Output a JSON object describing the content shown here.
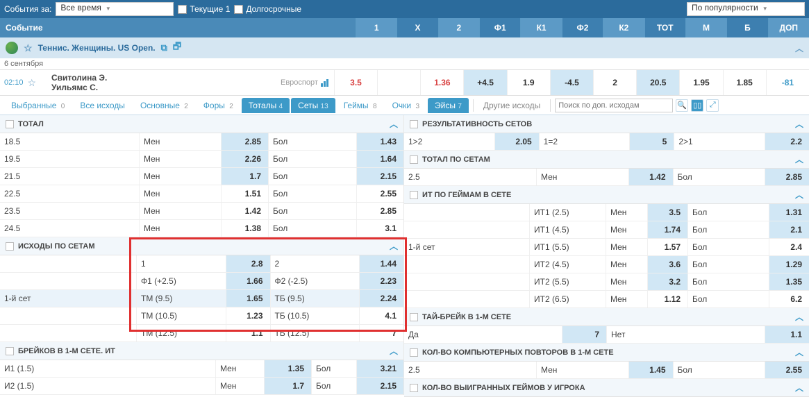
{
  "topbar": {
    "events_for": "События за:",
    "time_select": "Все время",
    "current": "Текущие 1",
    "longterm": "Долгосрочные",
    "sort_select": "По популярности"
  },
  "header": {
    "event": "Событие",
    "cols": [
      "1",
      "Х",
      "2",
      "Ф1",
      "К1",
      "Ф2",
      "К2",
      "ТОТ",
      "М",
      "Б",
      "ДОП"
    ]
  },
  "category": {
    "title": "Теннис. Женщины. US Open."
  },
  "date": "6 сентября",
  "match": {
    "time": "02:10",
    "p1": "Свитолина Э.",
    "p2": "Уильямс С.",
    "channel": "Евроспорт",
    "odds": [
      "3.5",
      "",
      "1.36",
      "+4.5",
      "1.9",
      "-4.5",
      "2",
      "20.5",
      "1.95",
      "1.85",
      "-81"
    ]
  },
  "tabs": {
    "selected": {
      "label": "Выбранные",
      "count": "0"
    },
    "all": {
      "label": "Все исходы"
    },
    "main": {
      "label": "Основные",
      "count": "2"
    },
    "handicap": {
      "label": "Форы",
      "count": "2"
    },
    "totals": {
      "label": "Тоталы",
      "count": "4"
    },
    "sets": {
      "label": "Сеты",
      "count": "13"
    },
    "games": {
      "label": "Геймы",
      "count": "8"
    },
    "points": {
      "label": "Очки",
      "count": "3"
    },
    "aces": {
      "label": "Эйсы",
      "count": "7"
    },
    "other": "Другие исходы",
    "search_ph": "Поиск по доп. исходам"
  },
  "sections": {
    "total": {
      "title": "ТОТАЛ",
      "rows": [
        {
          "p": "18.5",
          "l1": "Мен",
          "v1": "2.85",
          "l2": "Бол",
          "v2": "1.43"
        },
        {
          "p": "19.5",
          "l1": "Мен",
          "v1": "2.26",
          "l2": "Бол",
          "v2": "1.64"
        },
        {
          "p": "21.5",
          "l1": "Мен",
          "v1": "1.7",
          "l2": "Бол",
          "v2": "2.15"
        },
        {
          "p": "22.5",
          "l1": "Мен",
          "v1": "1.51",
          "l2": "Бол",
          "v2": "2.55"
        },
        {
          "p": "23.5",
          "l1": "Мен",
          "v1": "1.42",
          "l2": "Бол",
          "v2": "2.85"
        },
        {
          "p": "24.5",
          "l1": "Мен",
          "v1": "1.38",
          "l2": "Бол",
          "v2": "3.1"
        }
      ]
    },
    "bysets": {
      "title": "ИСХОДЫ ПО СЕТАМ",
      "set_label": "1-й сет",
      "rows": [
        {
          "l1": "1",
          "v1": "2.8",
          "l2": "2",
          "v2": "1.44"
        },
        {
          "l1": "Ф1 (+2.5)",
          "v1": "1.66",
          "l2": "Ф2 (-2.5)",
          "v2": "2.23"
        },
        {
          "l1": "ТМ (9.5)",
          "v1": "1.65",
          "l2": "ТБ (9.5)",
          "v2": "2.24"
        },
        {
          "l1": "ТМ (10.5)",
          "v1": "1.23",
          "l2": "ТБ (10.5)",
          "v2": "4.1"
        },
        {
          "l1": "ТМ (12.5)",
          "v1": "1.1",
          "l2": "ТБ (12.5)",
          "v2": "7"
        }
      ]
    },
    "breaks": {
      "title": "БРЕЙКОВ В 1-М СЕТЕ. ИТ",
      "rows": [
        {
          "p": "И1 (1.5)",
          "l1": "Мен",
          "v1": "1.35",
          "l2": "Бол",
          "v2": "3.21"
        },
        {
          "p": "И2 (1.5)",
          "l1": "Мен",
          "v1": "1.7",
          "l2": "Бол",
          "v2": "2.15"
        }
      ]
    },
    "setperf": {
      "title": "РЕЗУЛЬТАТИВНОСТЬ СЕТОВ",
      "r": {
        "a": "1>2",
        "av": "2.05",
        "b": "1=2",
        "bv": "5",
        "c": "2>1",
        "cv": "2.2"
      }
    },
    "totalbysets": {
      "title": "ТОТАЛ ПО СЕТАМ",
      "r": {
        "p": "2.5",
        "l1": "Мен",
        "v1": "1.42",
        "l2": "Бол",
        "v2": "2.85"
      }
    },
    "itgames": {
      "title": "ИТ ПО ГЕЙМАМ В СЕТЕ",
      "set_label": "1-й сет",
      "rows": [
        {
          "p": "ИТ1 (2.5)",
          "l1": "Мен",
          "v1": "3.5",
          "l2": "Бол",
          "v2": "1.31"
        },
        {
          "p": "ИТ1 (4.5)",
          "l1": "Мен",
          "v1": "1.74",
          "l2": "Бол",
          "v2": "2.1"
        },
        {
          "p": "ИТ1 (5.5)",
          "l1": "Мен",
          "v1": "1.57",
          "l2": "Бол",
          "v2": "2.4"
        },
        {
          "p": "ИТ2 (4.5)",
          "l1": "Мен",
          "v1": "3.6",
          "l2": "Бол",
          "v2": "1.29"
        },
        {
          "p": "ИТ2 (5.5)",
          "l1": "Мен",
          "v1": "3.2",
          "l2": "Бол",
          "v2": "1.35"
        },
        {
          "p": "ИТ2 (6.5)",
          "l1": "Мен",
          "v1": "1.12",
          "l2": "Бол",
          "v2": "6.2"
        }
      ]
    },
    "tiebreak": {
      "title": "ТАЙ-БРЕЙК В 1-М СЕТЕ",
      "r": {
        "a": "Да",
        "av": "7",
        "b": "Нет",
        "bv": "1.1"
      }
    },
    "replays": {
      "title": "КОЛ-ВО КОМПЬЮТЕРНЫХ ПОВТОРОВ В 1-М СЕТЕ",
      "r": {
        "p": "2.5",
        "l1": "Мен",
        "v1": "1.45",
        "l2": "Бол",
        "v2": "2.55"
      }
    },
    "wongames": {
      "title": "КОЛ-ВО ВЫИГРАННЫХ ГЕЙМОВ У ИГРОКА"
    }
  }
}
